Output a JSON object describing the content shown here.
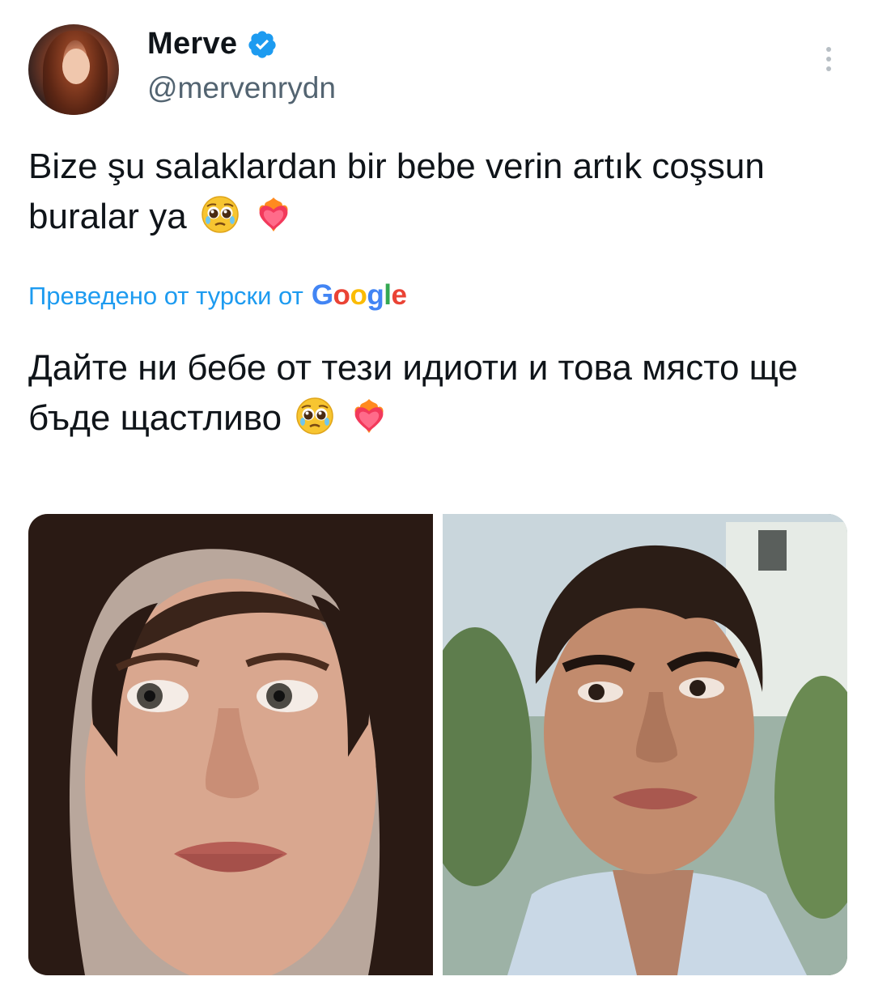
{
  "author": {
    "name": "Merve",
    "handle": "@mervenrydn",
    "verified": true,
    "avatar_icon": "profile-photo"
  },
  "tweet": {
    "original_text": "Bize şu salaklardan bir bebe verin artık coşsun buralar ya",
    "translation_label": "Преведено от турски от",
    "translation_provider": "Google",
    "translated_text": "Дайте ни бебе от тези идиоти и това място ще бъде щастливо",
    "emojis": [
      "pleading-face-icon",
      "heart-on-fire-icon"
    ]
  },
  "media": {
    "count": 2,
    "photos": [
      "woman-portrait-photo",
      "man-portrait-photo"
    ]
  },
  "colors": {
    "link": "#1d9bf0",
    "verified": "#1d9bf0",
    "secondary_text": "#536471",
    "primary_text": "#0f1419"
  }
}
